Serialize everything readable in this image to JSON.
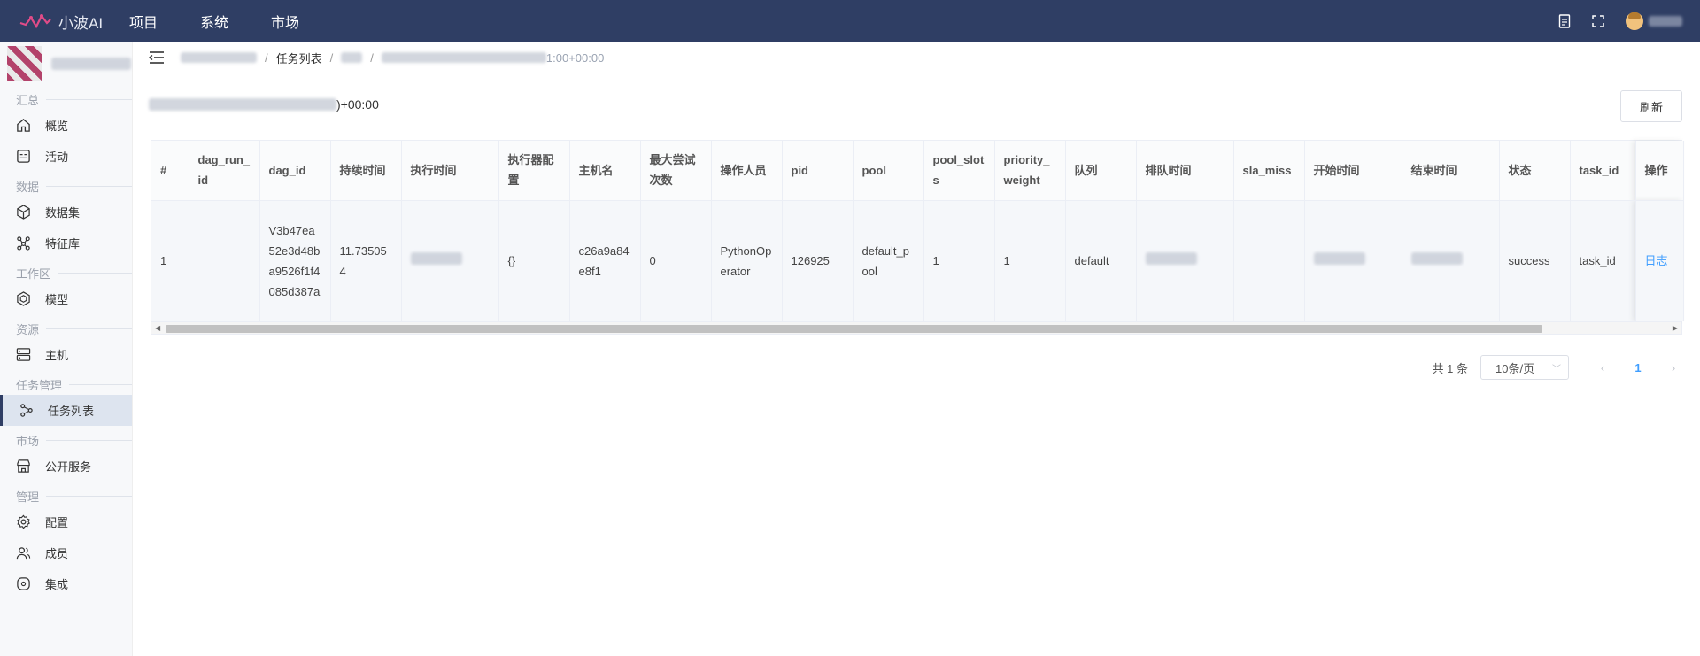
{
  "app": {
    "name": "小波AI",
    "brand_color": "#2f3e64",
    "accent": "#409eff"
  },
  "topnav": [
    "项目",
    "系统",
    "市场"
  ],
  "sidebar": {
    "groups": [
      {
        "title": "汇总",
        "items": [
          {
            "label": "概览",
            "icon": "home-icon"
          },
          {
            "label": "活动",
            "icon": "activity-icon"
          }
        ]
      },
      {
        "title": "数据",
        "items": [
          {
            "label": "数据集",
            "icon": "cube-icon"
          },
          {
            "label": "特征库",
            "icon": "feature-icon"
          }
        ]
      },
      {
        "title": "工作区",
        "items": [
          {
            "label": "模型",
            "icon": "model-icon"
          }
        ]
      },
      {
        "title": "资源",
        "items": [
          {
            "label": "主机",
            "icon": "server-icon"
          }
        ]
      },
      {
        "title": "任务管理",
        "items": [
          {
            "label": "任务列表",
            "icon": "share-icon",
            "active": true
          }
        ]
      },
      {
        "title": "市场",
        "items": [
          {
            "label": "公开服务",
            "icon": "store-icon"
          }
        ]
      },
      {
        "title": "管理",
        "items": [
          {
            "label": "配置",
            "icon": "gear-icon"
          },
          {
            "label": "成员",
            "icon": "users-icon"
          },
          {
            "label": "集成",
            "icon": "integration-icon"
          }
        ]
      }
    ]
  },
  "breadcrumb": {
    "task_list": "任务列表",
    "run_suffix": "1:00+00:00"
  },
  "subtitle_suffix": ")+00:00",
  "refresh_label": "刷新",
  "table": {
    "columns": [
      "#",
      "dag_run_id",
      "dag_id",
      "持续时间",
      "执行时间",
      "执行器配置",
      "主机名",
      "最大尝试次数",
      "操作人员",
      "pid",
      "pool",
      "pool_slots",
      "priority_weight",
      "队列",
      "排队时间",
      "sla_miss",
      "开始时间",
      "结束时间",
      "状态",
      "task_id",
      "操作"
    ],
    "rows": [
      {
        "index": "1",
        "dag_run_id": "",
        "dag_id": "V3b47ea52e3d48ba9526f1f4085d387a",
        "duration": "11.735054",
        "exec_config": "{}",
        "hostname": "c26a9a84e8f1",
        "max_tries": "0",
        "operator": "PythonOperator",
        "pid": "126925",
        "pool": "default_pool",
        "pool_slots": "1",
        "priority_weight": "1",
        "queue": "default",
        "sla_miss": "",
        "state": "success",
        "task_id": "task_id",
        "action": "日志"
      }
    ]
  },
  "pagination": {
    "total": "共 1 条",
    "page_size": "10条/页",
    "current": "1"
  }
}
